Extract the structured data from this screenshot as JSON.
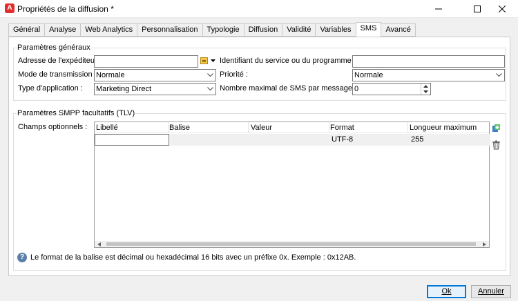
{
  "window": {
    "title": "Propriétés de la diffusion *",
    "app_icon_letter": "A"
  },
  "tabs": [
    {
      "label": "Général"
    },
    {
      "label": "Analyse"
    },
    {
      "label": "Web Analytics"
    },
    {
      "label": "Personnalisation"
    },
    {
      "label": "Typologie"
    },
    {
      "label": "Diffusion"
    },
    {
      "label": "Validité"
    },
    {
      "label": "Variables"
    },
    {
      "label": "SMS",
      "active": true
    },
    {
      "label": "Avancé"
    }
  ],
  "general": {
    "legend": "Paramètres généraux",
    "sender_label": "Adresse de l'expéditeur :",
    "sender_value": "",
    "service_label": "Identifiant du service ou du programme :",
    "service_value": "",
    "mode_label": "Mode de transmission :",
    "mode_value": "Normale",
    "priority_label": "Priorité :",
    "priority_value": "Normale",
    "apptype_label": "Type d'application :",
    "apptype_value": "Marketing Direct",
    "maxsms_label": "Nombre maximal de SMS par message :",
    "maxsms_value": "0"
  },
  "smpp": {
    "legend": "Paramètres SMPP facultatifs (TLV)",
    "optional_label": "Champs optionnels :",
    "columns": [
      "Libellé",
      "Balise",
      "Valeur",
      "Format",
      "Longueur maximum"
    ],
    "rows": [
      {
        "label": "",
        "tag": "",
        "value": "",
        "format": "UTF-8",
        "max_length": "255"
      }
    ],
    "info_text": "Le format de la balise est décimal ou hexadécimal 16 bits avec un préfixe 0x. Exemple : 0x12AB."
  },
  "footer": {
    "ok_label": "Ok",
    "cancel_label": "Annuler"
  },
  "colors": {
    "accent": "#0078d7",
    "app_icon": "#e32d2d",
    "info_icon": "#5a7fa8"
  }
}
